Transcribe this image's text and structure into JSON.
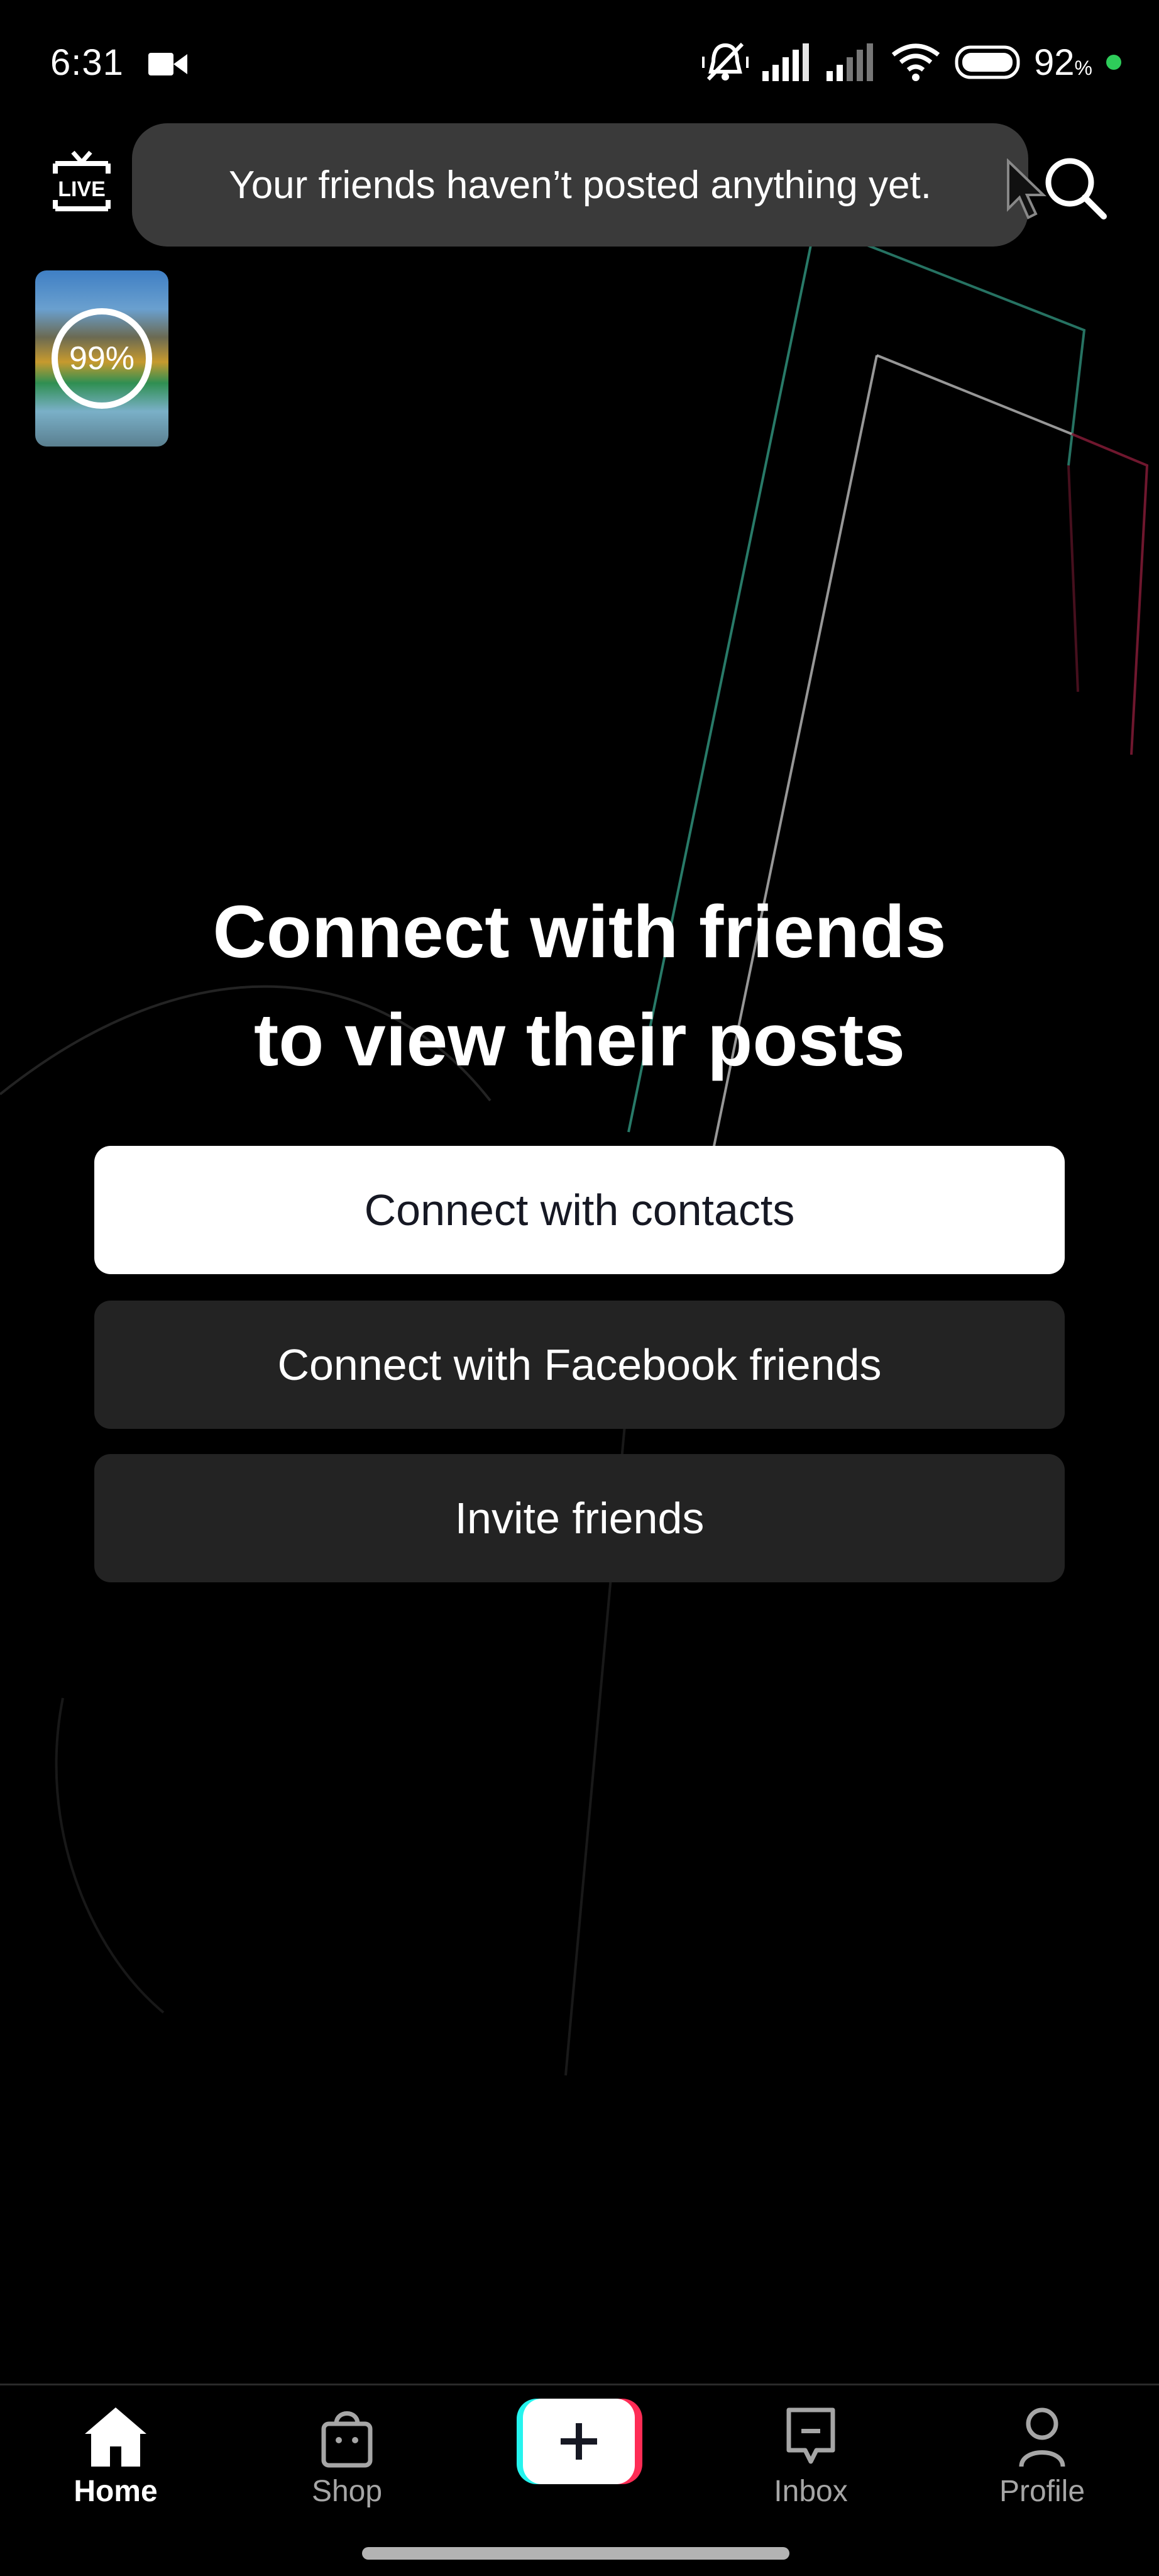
{
  "status_bar": {
    "time": "6:31",
    "battery_percent": "92",
    "battery_suffix": "%",
    "icons": [
      "video-camera-icon",
      "mute-icon",
      "signal-icon",
      "signal-icon",
      "wifi-icon",
      "battery-icon",
      "charging-dot"
    ],
    "charging_color": "#2ecc5a"
  },
  "top_bar": {
    "live_label": "LIVE",
    "toast_message": "Your friends haven’t posted anything yet.",
    "search_icon": "search-icon"
  },
  "upload_thumbnail": {
    "progress_label": "99%",
    "progress": 0.99
  },
  "main": {
    "heading_line1": "Connect with friends",
    "heading_line2": "to view their posts",
    "buttons": [
      {
        "label": "Connect with contacts",
        "style": "primary"
      },
      {
        "label": "Connect with Facebook friends",
        "style": "secondary"
      },
      {
        "label": "Invite friends",
        "style": "secondary"
      }
    ]
  },
  "bottom_nav": {
    "items": [
      {
        "label": "Home",
        "icon": "home-icon",
        "active": true
      },
      {
        "label": "Shop",
        "icon": "shop-bag-icon",
        "active": false
      },
      {
        "label": "",
        "icon": "create-plus-icon",
        "active": false
      },
      {
        "label": "Inbox",
        "icon": "inbox-icon",
        "active": false
      },
      {
        "label": "Profile",
        "icon": "profile-icon",
        "active": false
      }
    ]
  },
  "colors": {
    "accent_cyan": "#25f4ee",
    "accent_red": "#fe2c55",
    "background": "#000000",
    "toast_bg": "#3a3a3a",
    "secondary_button_bg": "#232323"
  }
}
